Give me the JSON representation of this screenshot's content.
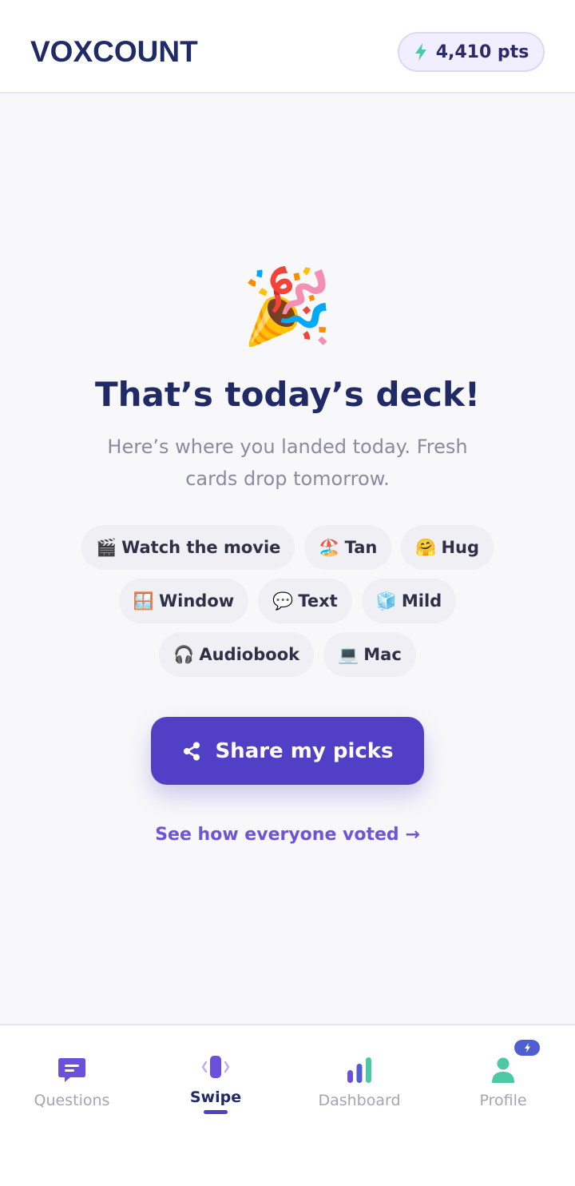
{
  "header": {
    "logo": "VOXCOUNT",
    "points_label": "4,410 pts",
    "points_icon": "lightning-icon"
  },
  "main": {
    "emoji": "🎉",
    "title": "That’s today’s deck!",
    "subtitle": "Here’s where you landed today. Fresh cards drop tomorrow.",
    "chips": [
      {
        "icon": "🎬",
        "label": "Watch the movie"
      },
      {
        "icon": "🏖️",
        "label": "Tan"
      },
      {
        "icon": "🤗",
        "label": "Hug"
      },
      {
        "icon": "🪟",
        "label": "Window"
      },
      {
        "icon": "💬",
        "label": "Text"
      },
      {
        "icon": "🧊",
        "label": "Mild"
      },
      {
        "icon": "🎧",
        "label": "Audiobook"
      },
      {
        "icon": "💻",
        "label": "Mac"
      }
    ],
    "share_label": "Share my picks",
    "see_link": "See how everyone voted →"
  },
  "nav": {
    "items": [
      {
        "label": "Questions",
        "icon": "chat-icon"
      },
      {
        "label": "Swipe",
        "icon": "swipe-card-icon",
        "active": true
      },
      {
        "label": "Dashboard",
        "icon": "bar-chart-icon"
      },
      {
        "label": "Profile",
        "icon": "person-icon"
      }
    ]
  },
  "colors": {
    "primary": "#5140c6",
    "navy": "#1f2a66",
    "accent_green": "#4cc9a4",
    "muted": "#a4a4b6"
  }
}
